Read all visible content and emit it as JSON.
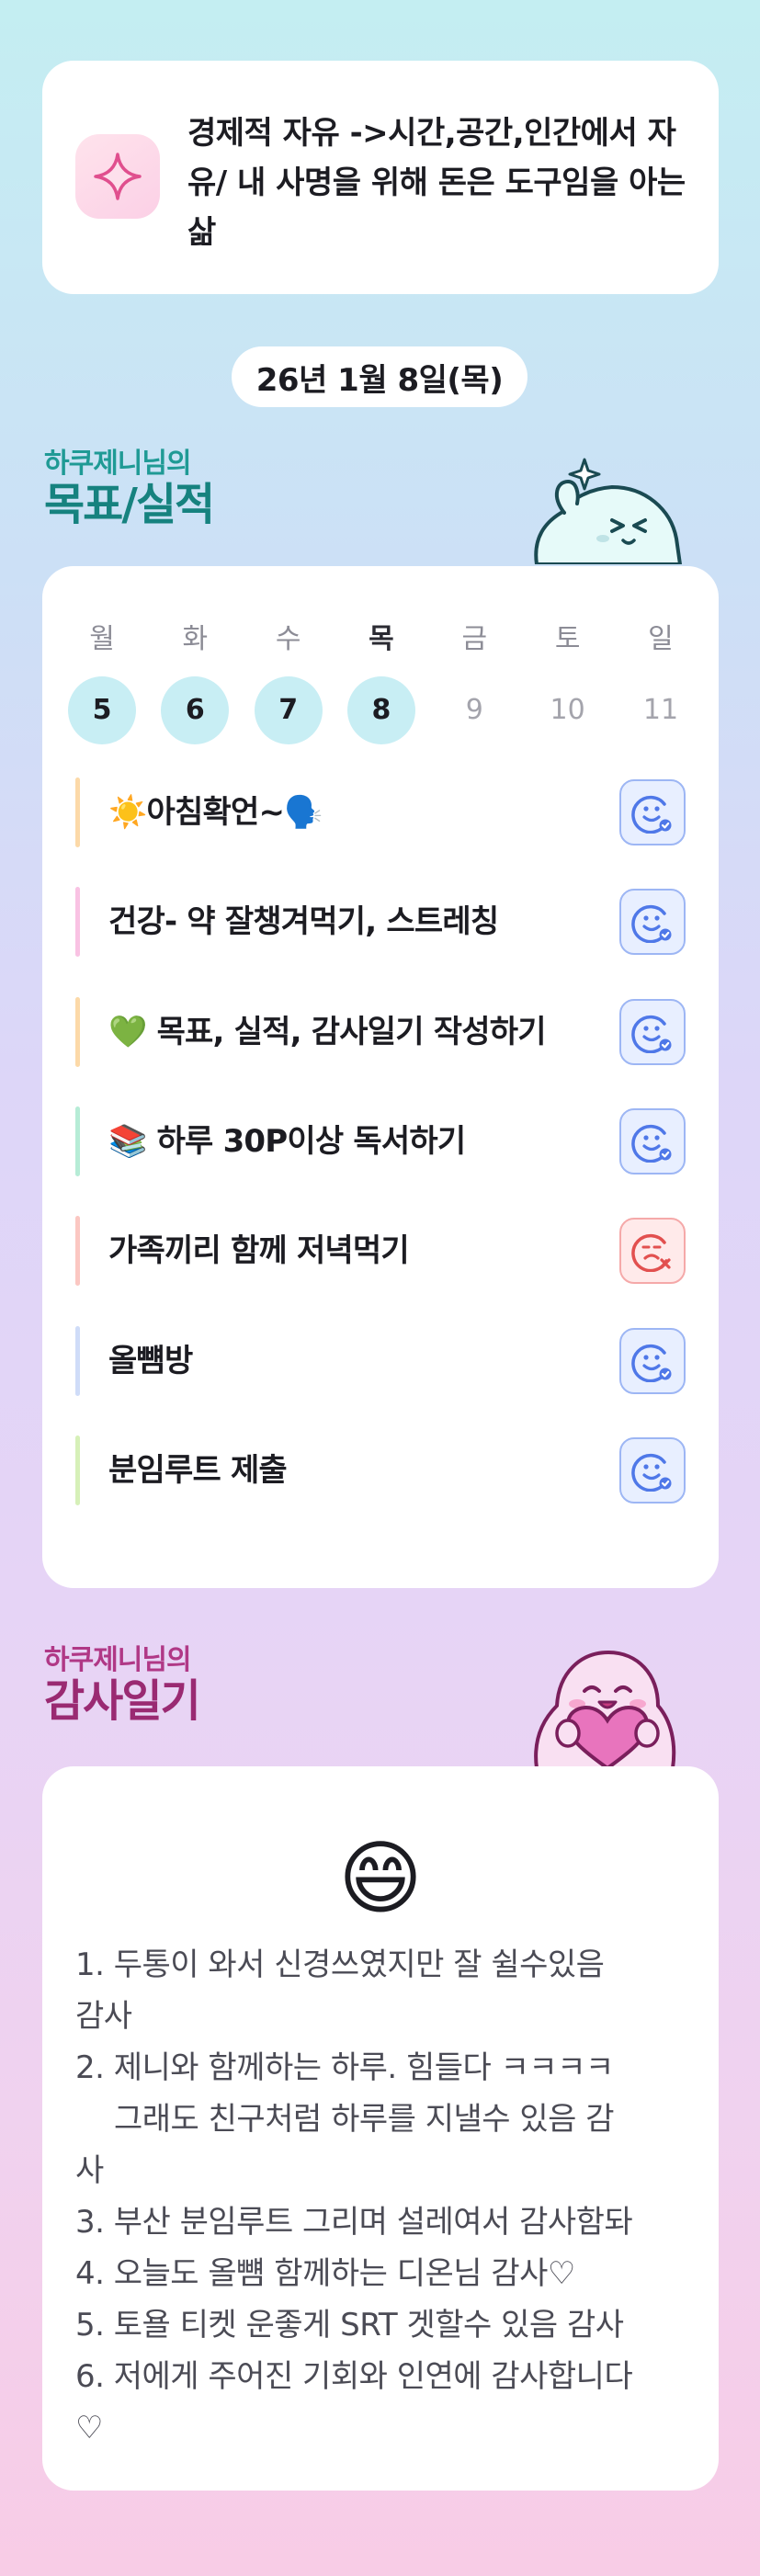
{
  "mission": {
    "icon": "sparkle-icon",
    "text": "경제적 자유 ->시간,공간,인간에서 자유/ 내 사명을 위해 돈은 도구임을 아는삶"
  },
  "date": "26년 1월 8일(목)",
  "goals_section": {
    "subtitle": "하쿠제니님의",
    "title": "목표/실적",
    "mascot_icon": "waving-ghost-mascot-icon"
  },
  "week": [
    {
      "name": "월",
      "num": "5",
      "done": true
    },
    {
      "name": "화",
      "num": "6",
      "done": true
    },
    {
      "name": "수",
      "num": "7",
      "done": true
    },
    {
      "name": "목",
      "num": "8",
      "done": true,
      "today": true
    },
    {
      "name": "금",
      "num": "9",
      "done": false
    },
    {
      "name": "토",
      "num": "10",
      "done": false
    },
    {
      "name": "일",
      "num": "11",
      "done": false
    }
  ],
  "goals": [
    {
      "label": "☀️아침확언~🗣️",
      "bar_color": "#fcd9a8",
      "status": "ok",
      "status_icon": "smile-check-icon"
    },
    {
      "label": "건강- 약 잘챙겨먹기, 스트레칭",
      "bar_color": "#f9c2e3",
      "status": "ok",
      "status_icon": "smile-check-icon"
    },
    {
      "label": "💚 목표, 실적, 감사일기 작성하기",
      "bar_color": "#fcd9a8",
      "status": "ok",
      "status_icon": "smile-check-icon"
    },
    {
      "label": "📚 하루 30P이상 독서하기",
      "bar_color": "#b6ecd6",
      "status": "ok",
      "status_icon": "smile-check-icon"
    },
    {
      "label": "가족끼리 함께 저녁먹기",
      "bar_color": "#fbc7c2",
      "status": "fail",
      "status_icon": "sad-x-icon"
    },
    {
      "label": "올뻄방",
      "bar_color": "#cfdcf8",
      "status": "ok",
      "status_icon": "smile-check-icon"
    },
    {
      "label": "분임루트 제출",
      "bar_color": "#d6f0b8",
      "status": "ok",
      "status_icon": "smile-check-icon"
    }
  ],
  "thanks_section": {
    "subtitle": "하쿠제니님의",
    "title": "감사일기",
    "mascot_icon": "heart-hugging-mascot-icon"
  },
  "thanks": {
    "emoji": "😄",
    "lines": [
      {
        "text": "1. 두통이 와서 신경쓰였지만 잘 쉴수있음",
        "indent": false
      },
      {
        "text": "감사",
        "indent": false
      },
      {
        "text": "2. 제니와 함께하는 하루. 힘들다 ㅋㅋㅋㅋ",
        "indent": false
      },
      {
        "text": "그래도 친구처럼 하루를 지낼수 있음 감",
        "indent": true
      },
      {
        "text": "사",
        "indent": false
      },
      {
        "text": "3. 부산 분임루트 그리며 설레여서 감사함돠",
        "indent": false
      },
      {
        "text": "4. 오늘도 올뻄 함께하는 디온님 감사♡",
        "indent": false
      },
      {
        "text": "5. 토욜 티켓 운좋게 SRT 겟할수 있음 감사",
        "indent": false
      },
      {
        "text": "6. 저에게 주어진 기회와 인연에 감사합니다",
        "indent": false
      },
      {
        "text": "♡",
        "indent": false
      }
    ]
  },
  "colors": {
    "accent_teal": "#16827f",
    "accent_magenta": "#9a2a72",
    "done_day": "#c8eef4",
    "status_ok": "#4f78e8",
    "status_fail": "#e2504f"
  }
}
